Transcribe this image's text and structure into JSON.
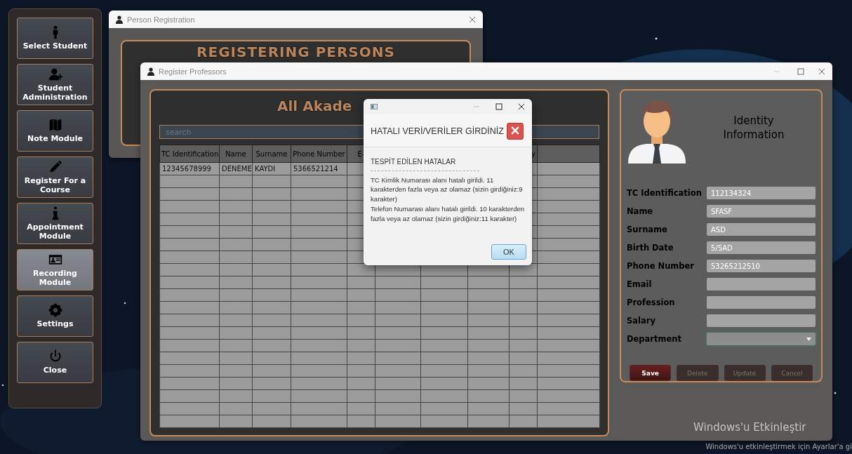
{
  "sidebar": {
    "items": [
      {
        "label": "Select Student",
        "selected": false
      },
      {
        "label": "Student Administration",
        "selected": false
      },
      {
        "label": "Note Module",
        "selected": false
      },
      {
        "label": "Register For a Course",
        "selected": false
      },
      {
        "label": "Appointment Module",
        "selected": false
      },
      {
        "label": "Recording Module",
        "selected": true
      },
      {
        "label": "Settings",
        "selected": false
      },
      {
        "label": "Close",
        "selected": false
      }
    ]
  },
  "person_registration": {
    "window": {
      "title": "Person Registration"
    },
    "heading": "REGISTERING PERSONS"
  },
  "register_professors": {
    "window": {
      "title": "Register Professors"
    },
    "list_panel": {
      "heading": "All Akade",
      "search": {
        "placeholder": "search"
      },
      "table": {
        "columns": [
          "TC Identification",
          "Name",
          "Surname",
          "Phone Number",
          "E-"
        ],
        "column_9": "y",
        "rows": [
          [
            "12345678999",
            "DENEME",
            "KAYDI",
            "5366521214"
          ]
        ]
      }
    },
    "form": {
      "heading": "Identity Information",
      "fields": [
        {
          "label": "TC Identification",
          "kind": "text",
          "value": "112134324"
        },
        {
          "label": "Name",
          "kind": "text",
          "value": "SFASF"
        },
        {
          "label": "Surname",
          "kind": "text",
          "value": "ASD"
        },
        {
          "label": "Birth Date",
          "kind": "text",
          "value": "5/SAD"
        },
        {
          "label": "Phone Number",
          "kind": "text",
          "value": "53265212510"
        },
        {
          "label": "Email",
          "kind": "text"
        },
        {
          "label": "Profession",
          "kind": "text"
        },
        {
          "label": "Salary",
          "kind": "text"
        },
        {
          "label": "Department",
          "kind": "select",
          "focused": true
        }
      ],
      "buttons": [
        {
          "label": "Save",
          "disabled": false
        },
        {
          "label": "Delete",
          "disabled": true
        },
        {
          "label": "Update",
          "disabled": true
        },
        {
          "label": "Cancel",
          "disabled": true
        }
      ]
    }
  },
  "error_dialog": {
    "header": "HATALI VERİ/VERİLER GİRDİNİZ",
    "subtitle": "TESPİT EDİLEN HATALAR",
    "messages": [
      "TC Kimlik Numarası alanı hatalı girildi. 11 karakterden fazla veya az olamaz (sizin girdiğiniz:9 karakter)",
      "Telefon Numarası alanı hatalı girildi. 10 karakterden fazla veya az olamaz (sizin girdiğiniz:11 karakter)"
    ],
    "button": "OK"
  },
  "activation_notice": {
    "title": "Windows'u Etkinleştir",
    "text": "Windows'u etkinleştirmek için Ayarlar'a gi"
  }
}
